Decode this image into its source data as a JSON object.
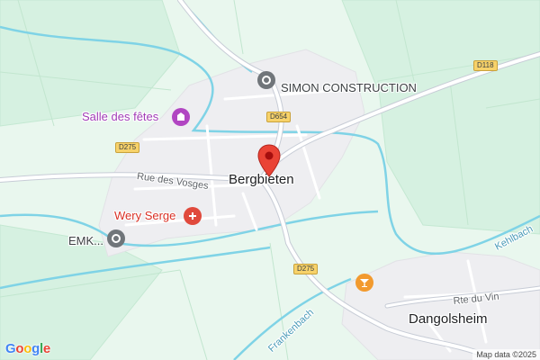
{
  "map": {
    "colors": {
      "land": "#e9f7ee",
      "field": "#cfeedd",
      "built": "#eeeef1",
      "water": "#7fd3e6",
      "road": "#ffffff",
      "major_road": "#c7ccd6",
      "pin": "#ea4335",
      "gray_poi": "#70757a",
      "purple_poi": "#b145c2",
      "red_poi": "#e0493c",
      "orange_poi": "#f29a2e"
    },
    "places": {
      "bergbieten": "Bergbieten",
      "dangolsheim": "Dangolsheim"
    },
    "pois": {
      "simon": "SIMON CONSTRUCTION",
      "salle": "Salle des fêtes",
      "wery": "Wery Serge",
      "emk": "EMK..."
    },
    "streets": {
      "rue_vosges": "Rue des Vosges",
      "rte_vin": "Rte du Vin"
    },
    "waterways": {
      "frankenbach": "Frankenbach",
      "kehlbach": "Kehlbach"
    },
    "roads": {
      "d118": "D118",
      "d654": "D654",
      "d275_west": "D275",
      "d275_south": "D275"
    },
    "icons": {
      "pin": "map-pin-icon",
      "simon": "company-icon",
      "salle": "event-venue-icon",
      "wery": "medical-icon",
      "emk": "company-icon",
      "bar": "cocktail-bar-icon"
    },
    "attribution": "Map data ©2025",
    "logo": [
      "G",
      "o",
      "o",
      "g",
      "l",
      "e"
    ]
  }
}
